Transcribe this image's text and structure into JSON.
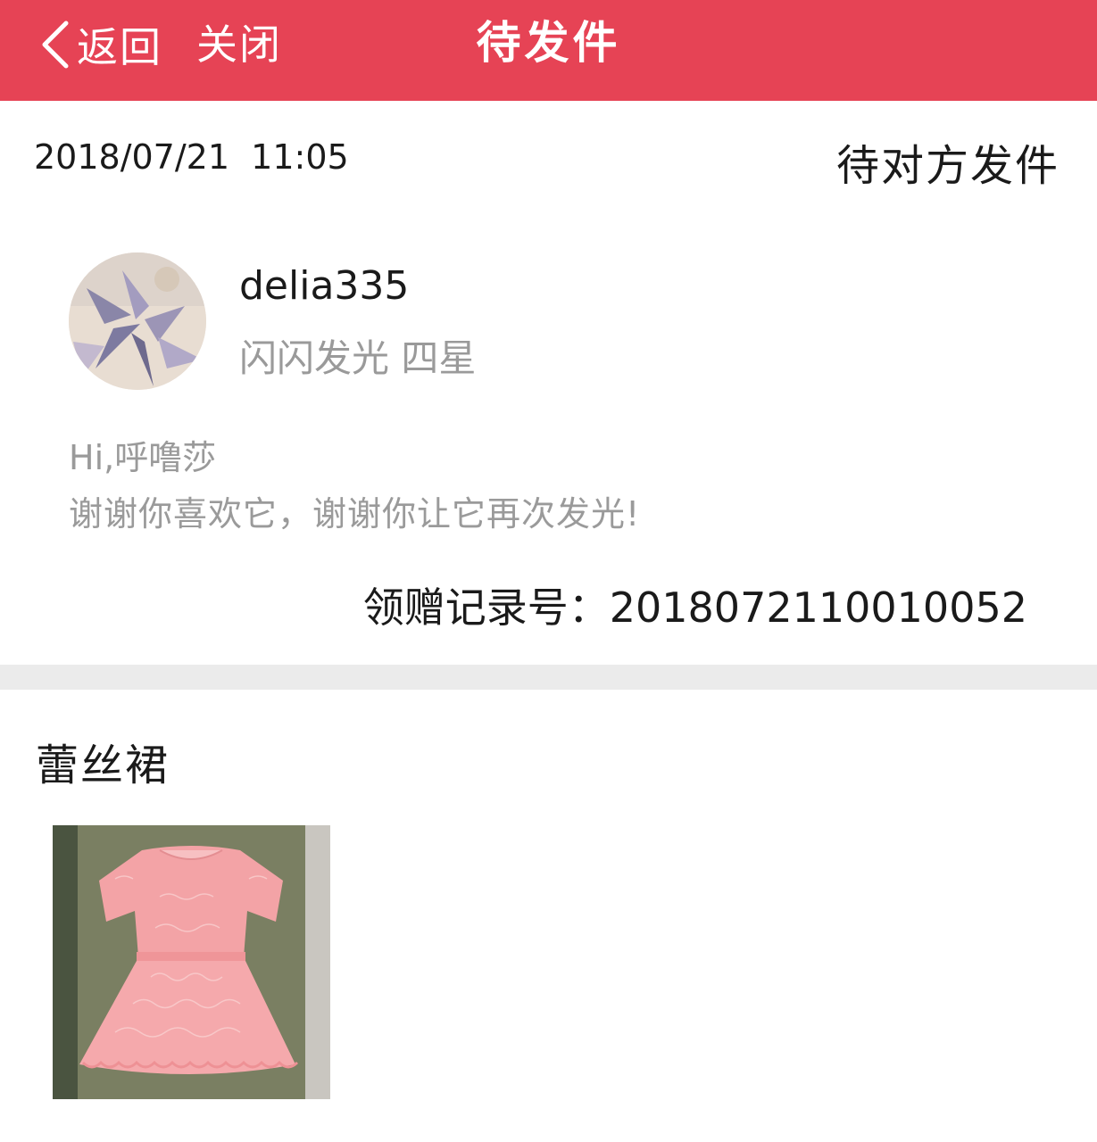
{
  "header": {
    "back_label": "返回",
    "close_label": "关闭",
    "title": "待发件",
    "bg_color": "#e64355"
  },
  "order": {
    "datetime": "2018/07/21  11:05",
    "status": "待对方发件"
  },
  "donor": {
    "name": "delia335",
    "level": "闪闪发光 四星"
  },
  "message": {
    "greeting": "Hi,呼噜莎",
    "body": "谢谢你喜欢它，谢谢你让它再次发光!"
  },
  "record": {
    "label": "领赠记录号：",
    "number": "2018072110010052"
  },
  "item": {
    "title": "蕾丝裙",
    "image_icon": "pink-lace-dress-photo"
  }
}
